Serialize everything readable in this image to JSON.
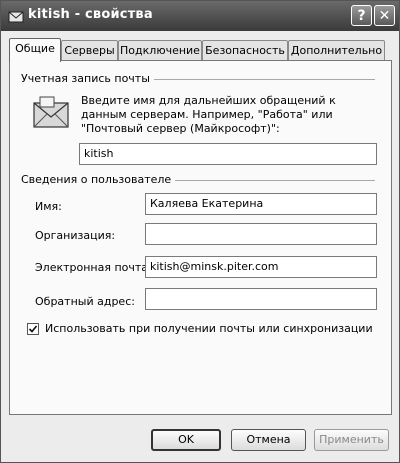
{
  "window": {
    "title": "kitish - свойства"
  },
  "titlebar": {
    "help_glyph": "?",
    "close_glyph": "✕"
  },
  "tabs": [
    {
      "label": "Общие",
      "active": true
    },
    {
      "label": "Серверы",
      "active": false
    },
    {
      "label": "Подключение",
      "active": false
    },
    {
      "label": "Безопасность",
      "active": false
    },
    {
      "label": "Дополнительно",
      "active": false
    }
  ],
  "mail_account": {
    "group_title": "Учетная запись почты",
    "description": "Введите имя для дальнейших обращений к данным серверам. Например, \"Работа\" или \"Почтовый сервер (Майкрософт)\":",
    "account_name": "kitish"
  },
  "user_info": {
    "group_title": "Сведения о пользователе",
    "name_label": "Имя:",
    "name_value": "Каляева Екатерина",
    "org_label": "Организация:",
    "org_value": "",
    "email_label": "Электронная почта:",
    "email_value": "kitish@minsk.piter.com",
    "reply_label": "Обратный адрес:",
    "reply_value": ""
  },
  "sync_checkbox": {
    "label": "Использовать при получении почты или синхронизации",
    "checked": true
  },
  "buttons": {
    "ok": "OK",
    "cancel": "Отмена",
    "apply": "Применить"
  },
  "icons": {
    "app": "mail-account-icon",
    "account": "envelope-icon",
    "help": "help-icon",
    "close": "close-icon"
  }
}
